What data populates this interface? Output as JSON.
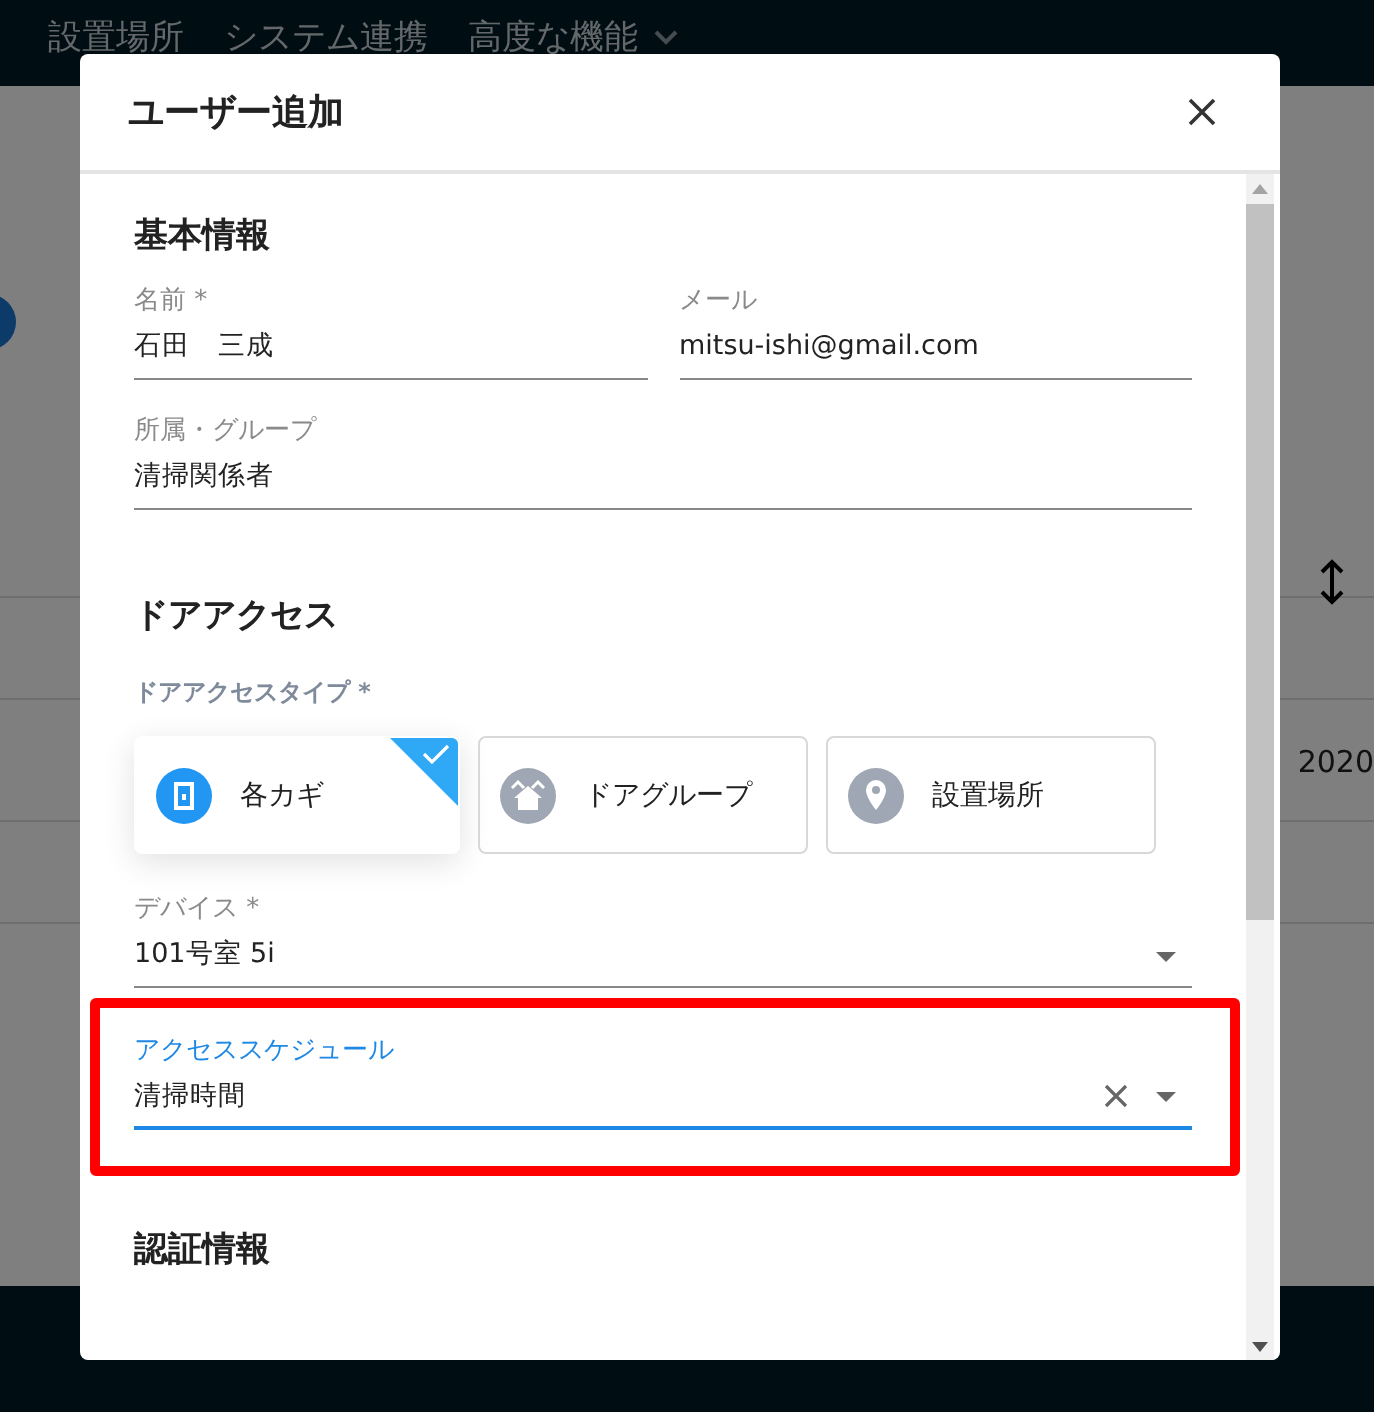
{
  "nav": {
    "items": [
      {
        "label": "設置場所",
        "dropdown": false
      },
      {
        "label": "システム連携",
        "dropdown": false
      },
      {
        "label": "高度な機能",
        "dropdown": true
      }
    ]
  },
  "background": {
    "cell": "2020"
  },
  "dialog": {
    "title": "ユーザー追加",
    "basic": {
      "heading": "基本情報",
      "fields": [
        {
          "label": "名前 *",
          "value": "石田　三成",
          "wide": false
        },
        {
          "label": "メール",
          "value": "mitsu-ishi@gmail.com",
          "wide": false
        },
        {
          "label": "所属・グループ",
          "value": "清掃関係者",
          "wide": true
        }
      ]
    },
    "door_access": {
      "heading": "ドアアクセス",
      "type_label": "ドアアクセスタイプ *",
      "options": [
        {
          "label": "各カギ",
          "kind": "door",
          "selected": true
        },
        {
          "label": "ドアグループ",
          "kind": "house",
          "selected": false
        },
        {
          "label": "設置場所",
          "kind": "pin",
          "selected": false
        }
      ],
      "device": {
        "label": "デバイス *",
        "value": "101号室 5i"
      },
      "schedule": {
        "label": "アクセススケジュール",
        "value": "清掃時間",
        "focused": true,
        "highlighted": true
      }
    },
    "auth": {
      "heading": "認証情報"
    }
  }
}
